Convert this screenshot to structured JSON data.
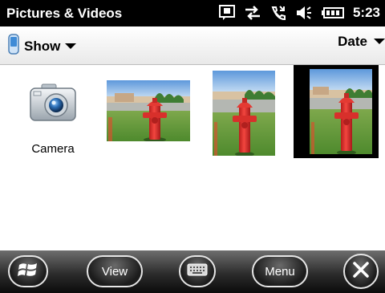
{
  "status": {
    "app_title": "Pictures & Videos",
    "time": "5:23",
    "icons": [
      "notification-icon",
      "data-sync-icon",
      "missed-call-icon",
      "volume-icon",
      "battery-icon"
    ]
  },
  "toolbar": {
    "show_label": "Show",
    "sort_label": "Date"
  },
  "items": [
    {
      "label": "Camera",
      "icon": "camera-icon"
    }
  ],
  "photos": [
    {
      "name": "fire hydrant photo 1",
      "selected": false
    },
    {
      "name": "fire hydrant photo 2",
      "selected": false
    },
    {
      "name": "fire hydrant photo 3",
      "selected": true
    }
  ],
  "softkeys": {
    "left_label": "View",
    "right_label": "Menu",
    "start_icon": "windows-start-icon",
    "keyboard_icon": "keyboard-icon",
    "close_icon": "close-icon"
  },
  "colors": {
    "hydrant_red": "#e8332f",
    "grass_green": "#5e9a37",
    "sky_blue": "#7fb4e4",
    "selection": "#000000"
  }
}
